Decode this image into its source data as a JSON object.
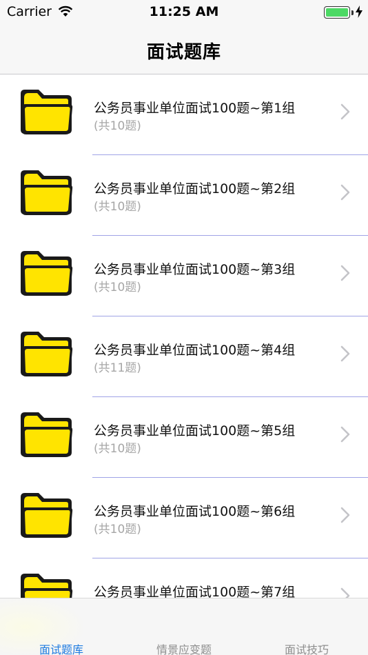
{
  "status_bar": {
    "carrier": "Carrier",
    "time": "11:25 AM"
  },
  "nav": {
    "title": "面试题库"
  },
  "colors": {
    "accent": "#1e7be0",
    "folder": "#ffe400",
    "separator": "#9fa3e6",
    "subtitle": "#a6a6a6"
  },
  "list": {
    "items": [
      {
        "title": "公务员事业单位面试100题~第1组",
        "subtitle": "(共10题)",
        "icon": "folder-icon"
      },
      {
        "title": "公务员事业单位面试100题~第2组",
        "subtitle": "(共10题)",
        "icon": "folder-icon"
      },
      {
        "title": "公务员事业单位面试100题~第3组",
        "subtitle": "(共10题)",
        "icon": "folder-icon"
      },
      {
        "title": "公务员事业单位面试100题~第4组",
        "subtitle": "(共11题)",
        "icon": "folder-icon"
      },
      {
        "title": "公务员事业单位面试100题~第5组",
        "subtitle": "(共10题)",
        "icon": "folder-icon"
      },
      {
        "title": "公务员事业单位面试100题~第6组",
        "subtitle": "(共10题)",
        "icon": "folder-icon"
      },
      {
        "title": "公务员事业单位面试100题~第7组",
        "subtitle": "",
        "icon": "folder-icon"
      }
    ]
  },
  "tab_bar": {
    "tabs": [
      {
        "label": "面试题库",
        "active": true
      },
      {
        "label": "情景应变题",
        "active": false
      },
      {
        "label": "面试技巧",
        "active": false
      }
    ]
  }
}
